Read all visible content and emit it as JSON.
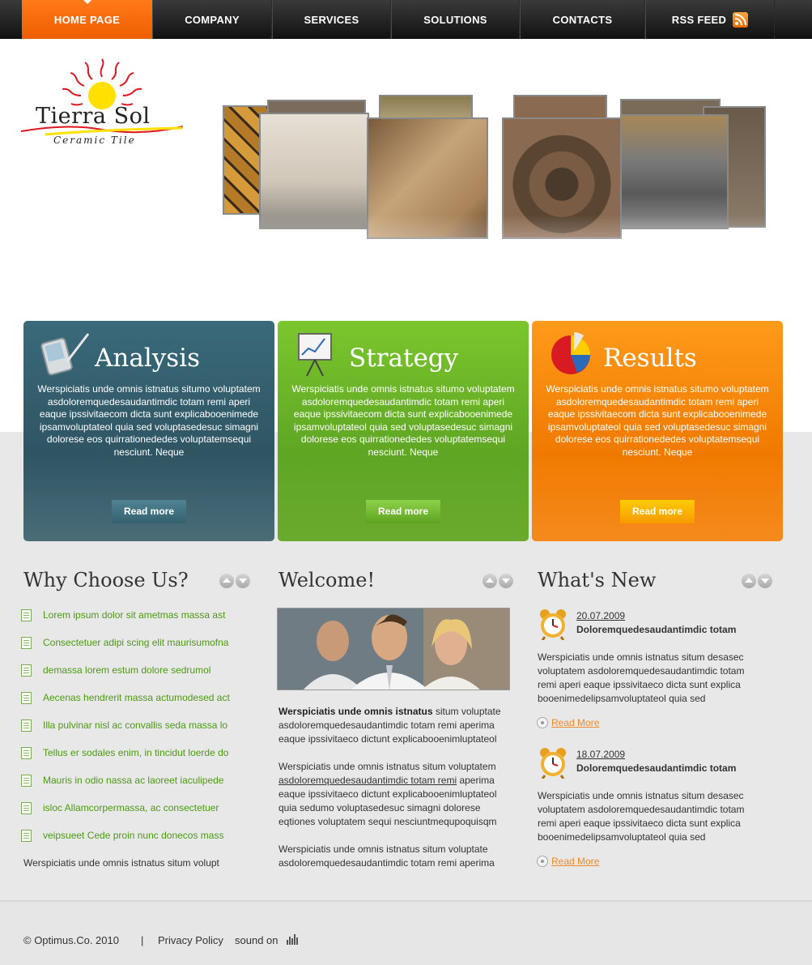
{
  "nav": {
    "items": [
      {
        "label": "HOME PAGE"
      },
      {
        "label": "COMPANY"
      },
      {
        "label": "SERVICES"
      },
      {
        "label": "SOLUTIONS"
      },
      {
        "label": "CONTACTS"
      },
      {
        "label": "RSS FEED"
      }
    ],
    "active_color": "#f26a00"
  },
  "logo": {
    "name": "Tierra Sol",
    "sub": "Ceramic Tile"
  },
  "features": [
    {
      "title": "Analysis",
      "text": "Werspiciatis unde omnis istnatus situmo voluptatem asdoloremquedesaudantimdic totam remi aperi eaque ipssivitaecom dicta sunt explicabooenimede  ipsamvoluptateol quia sed voluptasedesuc simagni dolorese eos quirrationededes voluptatemsequi nesciunt. Neque",
      "button": "Read more",
      "color": "#2f5563"
    },
    {
      "title": "Strategy",
      "text": "Werspiciatis unde omnis istnatus situmo voluptatem asdoloremquedesaudantimdic totam remi aperi eaque ipssivitaecom dicta sunt explicabooenimede  ipsamvoluptateol quia sed voluptasedesuc simagni dolorese eos quirrationededes voluptatemsequi nesciunt. Neque",
      "button": "Read more",
      "color": "#5fa624"
    },
    {
      "title": "Results",
      "text": "Werspiciatis unde omnis istnatus situmo voluptatem asdoloremquedesaudantimdic totam remi aperi eaque ipssivitaecom dicta sunt explicabooenimede  ipsamvoluptateol quia sed voluptasedesuc simagni dolorese eos quirrationededes voluptatemsequi nesciunt. Neque",
      "button": "Read more",
      "color": "#f07a00"
    }
  ],
  "why": {
    "title": "Why Choose Us?",
    "items": [
      "Lorem ipsum dolor sit ametmas massa ast",
      "Consectetuer adipi scing elit maurisumofna",
      "demassa lorem estum dolore sedrumol",
      "Aecenas hendrerit massa actumodesed act",
      "Illa pulvinar nisl ac convallis seda massa lo",
      "Tellus er sodales enim, in tincidut loerde do",
      "Mauris in odio nassa ac laoreet iaculipede",
      "isloc Allamcorpermassa, ac consectetuer",
      "veipsueet Cede proin nunc donecos mass"
    ],
    "footer": "Werspiciatis unde omnis istnatus situm volupt"
  },
  "welcome": {
    "title": "Welcome!",
    "p1_bold": "Werspiciatis unde omnis istnatus",
    "p1_rest": " situm voluptate asdoloremquedesaudantimdic totam remi aperima eaque ipssivitaeco dictunt explicabooenimluptateol",
    "p2_start": "Werspiciatis unde omnis istnatus situm voluptatem ",
    "p2_link": "asdoloremquedesaudantimdic totam remi",
    "p2_end": " aperima eaque ipssivitaeco dictunt explicabooenimluptateol quia sedumo voluptasedesuc simagni dolorese eqtiones voluptatem sequi nesciuntmequpoquisqm",
    "p3": "Werspiciatis unde omnis istnatus situm voluptate asdoloremquedesaudantimdic totam remi aperima"
  },
  "news": {
    "title": "What's New",
    "items": [
      {
        "date": "20.07.2009",
        "headline": "Doloremquedesaudantimdic totam",
        "text": "Werspiciatis unde omnis istnatus situm desasec voluptatem asdoloremquedesaudantimdic totam remi aperi eaque ipssivitaeco dicta sunt explica booenimedelipsamvoluptateol quia sed",
        "more": "Read More"
      },
      {
        "date": "18.07.2009",
        "headline": "Doloremquedesaudantimdic totam",
        "text": "Werspiciatis unde omnis istnatus situm desasec voluptatem asdoloremquedesaudantimdic totam remi aperi eaque ipssivitaeco dicta sunt explica booenimedelipsamvoluptateol quia sed",
        "more": "Read More"
      }
    ]
  },
  "footer": {
    "copyright": "© Optimus.Co. 2010",
    "separator": "|",
    "privacy": "Privacy Policy",
    "sound": "sound on"
  }
}
